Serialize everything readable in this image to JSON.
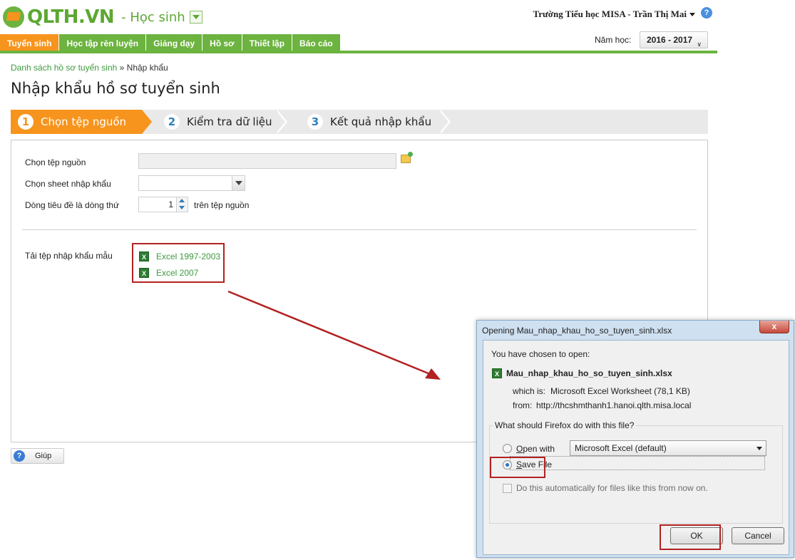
{
  "header": {
    "logo_text": "QLTH.VN",
    "role": "- Học sinh",
    "user": "Trường Tiểu học MISA - Trần Thị Mai",
    "year_label": "Năm học:",
    "year_value": "2016 - 2017"
  },
  "menu": [
    {
      "label": "Tuyển sinh"
    },
    {
      "label": "Học tập rèn luyện"
    },
    {
      "label": "Giảng dạy"
    },
    {
      "label": "Hồ sơ"
    },
    {
      "label": "Thiết lập"
    },
    {
      "label": "Báo cáo"
    }
  ],
  "breadcrumb": {
    "link": "Danh sách hồ sơ tuyển sinh",
    "sep": "»",
    "current": "Nhập khẩu"
  },
  "page_title": "Nhập khẩu hồ sơ tuyển sinh",
  "steps": [
    {
      "num": "1",
      "label": "Chọn tệp nguồn"
    },
    {
      "num": "2",
      "label": "Kiểm tra dữ liệu"
    },
    {
      "num": "3",
      "label": "Kết quả nhập khẩu"
    }
  ],
  "form": {
    "source_label": "Chọn tệp nguồn",
    "sheet_label": "Chọn sheet nhập khẩu",
    "header_row_label": "Dòng tiêu đề là dòng thứ",
    "header_row_value": "1",
    "header_row_suffix": "trên tệp nguồn",
    "template_label": "Tải tệp nhập khẩu mẫu",
    "template_links": [
      "Excel 1997-2003",
      "Excel 2007"
    ]
  },
  "help_button": "Giúp",
  "dialog": {
    "title": "Opening Mau_nhap_khau_ho_so_tuyen_sinh.xlsx",
    "close": "x",
    "chosen": "You have chosen to open:",
    "filename": "Mau_nhap_khau_ho_so_tuyen_sinh.xlsx",
    "which_is_label": "which is:",
    "which_is_value": "Microsoft Excel Worksheet (78,1 KB)",
    "from_label": "from:",
    "from_value": "http://thcshmthanh1.hanoi.qlth.misa.local",
    "question": "What should Firefox do with this file?",
    "open_with_prefix": "O",
    "open_with_rest": "pen with",
    "app": "Microsoft Excel (default)",
    "save_prefix": "S",
    "save_rest": "ave File",
    "auto": "Do this automatically for files like this from now on.",
    "ok": "OK",
    "cancel": "Cancel"
  },
  "colors": {
    "green": "#6cb33f",
    "orange": "#f7941d",
    "highlight": "#b22222"
  }
}
